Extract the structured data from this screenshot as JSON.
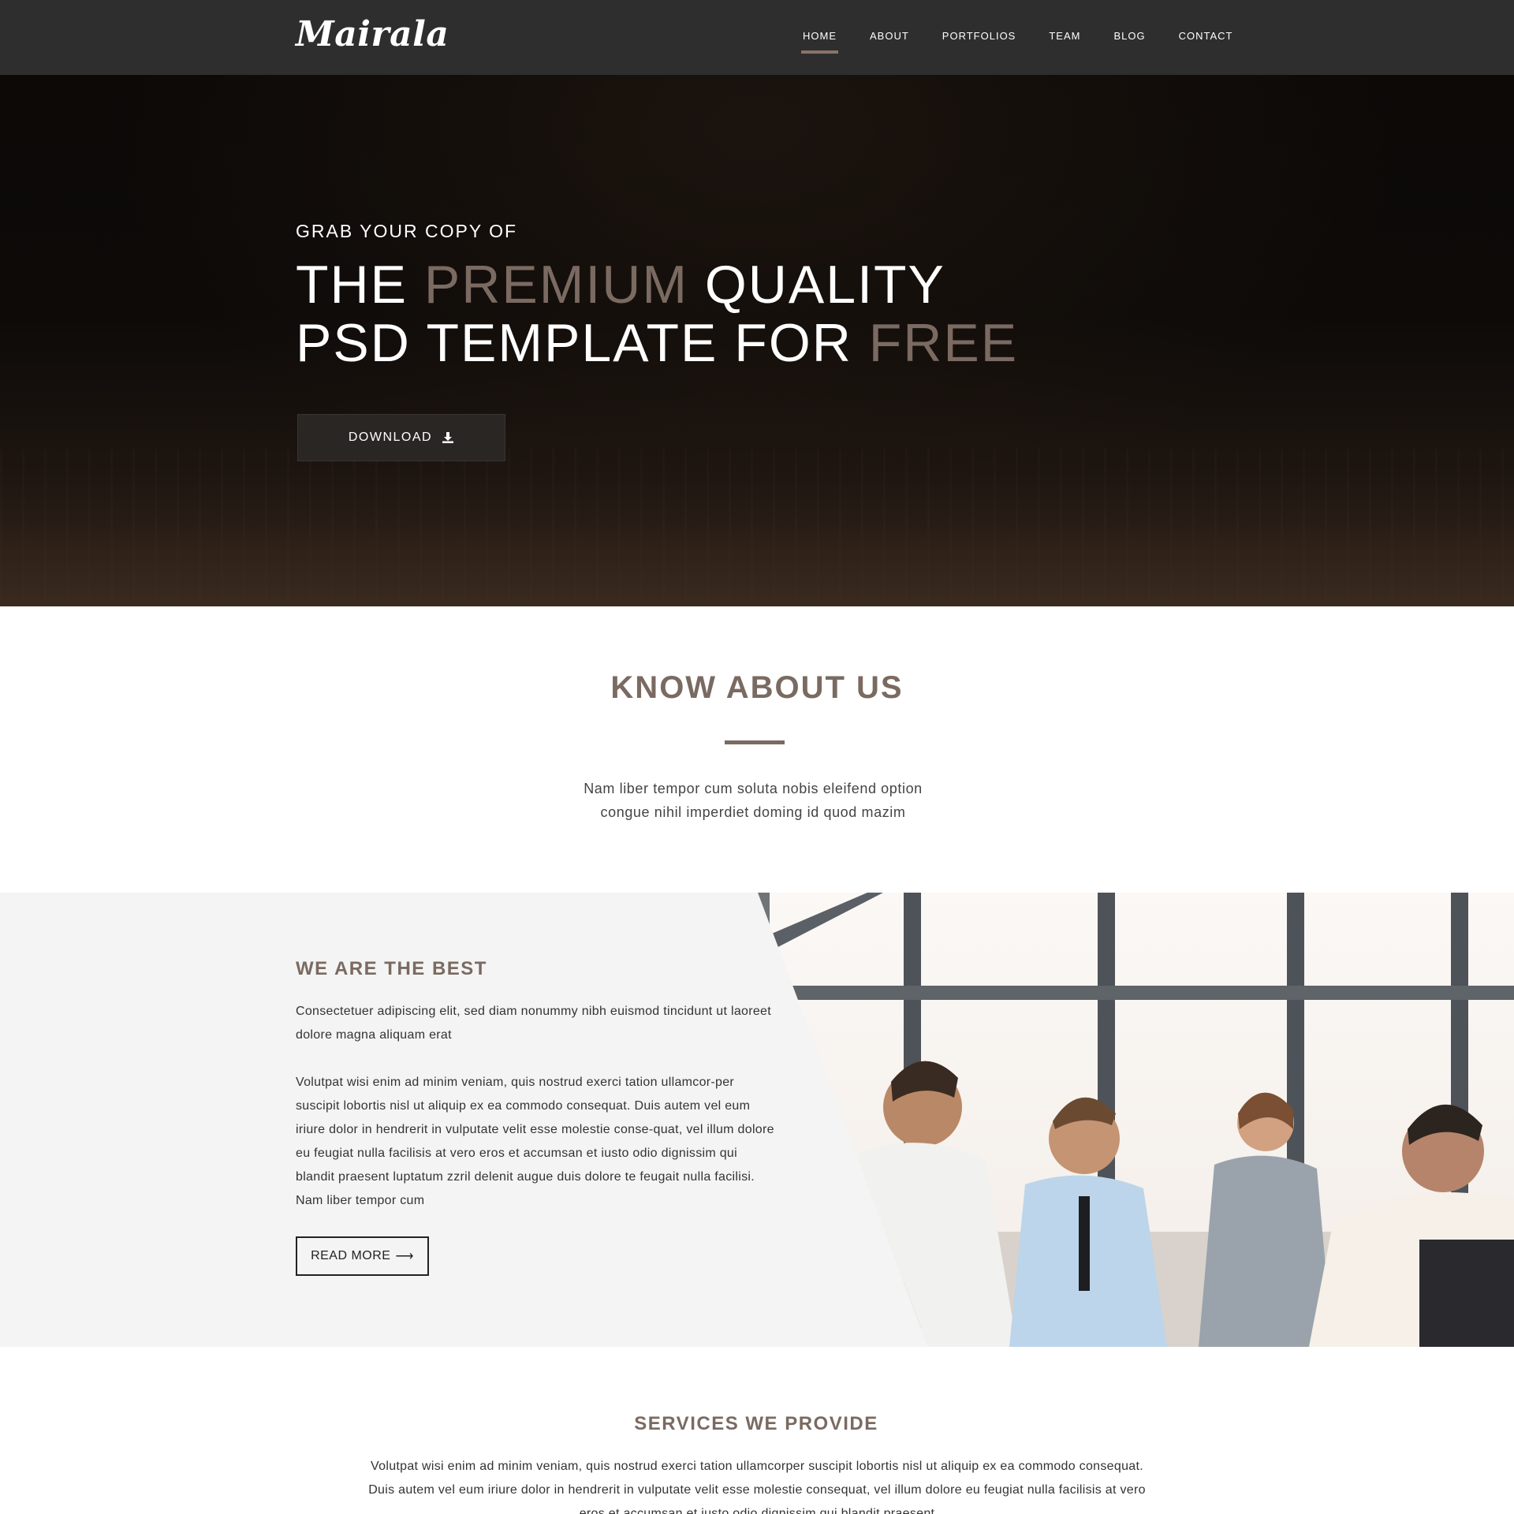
{
  "brand": {
    "logo": "Mairala"
  },
  "nav": {
    "items": [
      {
        "label": "HOME",
        "active": true
      },
      {
        "label": "ABOUT",
        "active": false
      },
      {
        "label": "PORTFOLIOS",
        "active": false
      },
      {
        "label": "TEAM",
        "active": false
      },
      {
        "label": "BLOG",
        "active": false
      },
      {
        "label": "CONTACT",
        "active": false
      }
    ]
  },
  "hero": {
    "pretitle": "GRAB YOUR COPY OF",
    "line1_a": "THE ",
    "line1_accent": "PREMIUM",
    "line1_b": " QUALITY",
    "line2_a": "PSD TEMPLATE FOR ",
    "line2_accent": "FREE",
    "download_label": "DOWNLOAD",
    "download_icon": "download-icon"
  },
  "about": {
    "title": "KNOW ABOUT US",
    "text_line1": "Nam liber tempor cum soluta nobis eleifend option",
    "text_line2": "congue nihil imperdiet doming id quod mazim"
  },
  "best": {
    "title": "WE ARE THE BEST",
    "p1": "Consectetuer adipiscing elit, sed diam nonummy nibh euismod tincidunt ut laoreet dolore magna aliquam erat",
    "p2": "Volutpat wisi enim ad minim veniam, quis nostrud exerci tation ullamcor-per suscipit lobortis nisl ut aliquip ex ea commodo consequat. Duis autem vel eum iriure dolor in hendrerit in vulputate velit esse molestie conse-quat, vel illum dolore eu feugiat nulla facilisis at vero eros et accumsan et iusto odio dignissim qui blandit praesent luptatum zzril delenit augue duis dolore te feugait nulla facilisi. Nam liber tempor cum",
    "readmore_label": "READ MORE",
    "readmore_arrow": "⟶"
  },
  "services": {
    "title": "SERVICES WE PROVIDE",
    "text": "Volutpat wisi enim ad minim veniam, quis nostrud exerci tation ullamcorper suscipit lobortis nisl ut aliquip ex ea commodo consequat. Duis autem vel eum iriure dolor in hendrerit in vulputate velit esse molestie consequat, vel illum dolore eu feugiat nulla facilisis at vero eros et accumsan et iusto odio dignissim qui blandit praesent"
  },
  "colors": {
    "accent": "#7a6a61",
    "navbar": "#2e2e2e",
    "section_bg": "#f4f4f4"
  }
}
